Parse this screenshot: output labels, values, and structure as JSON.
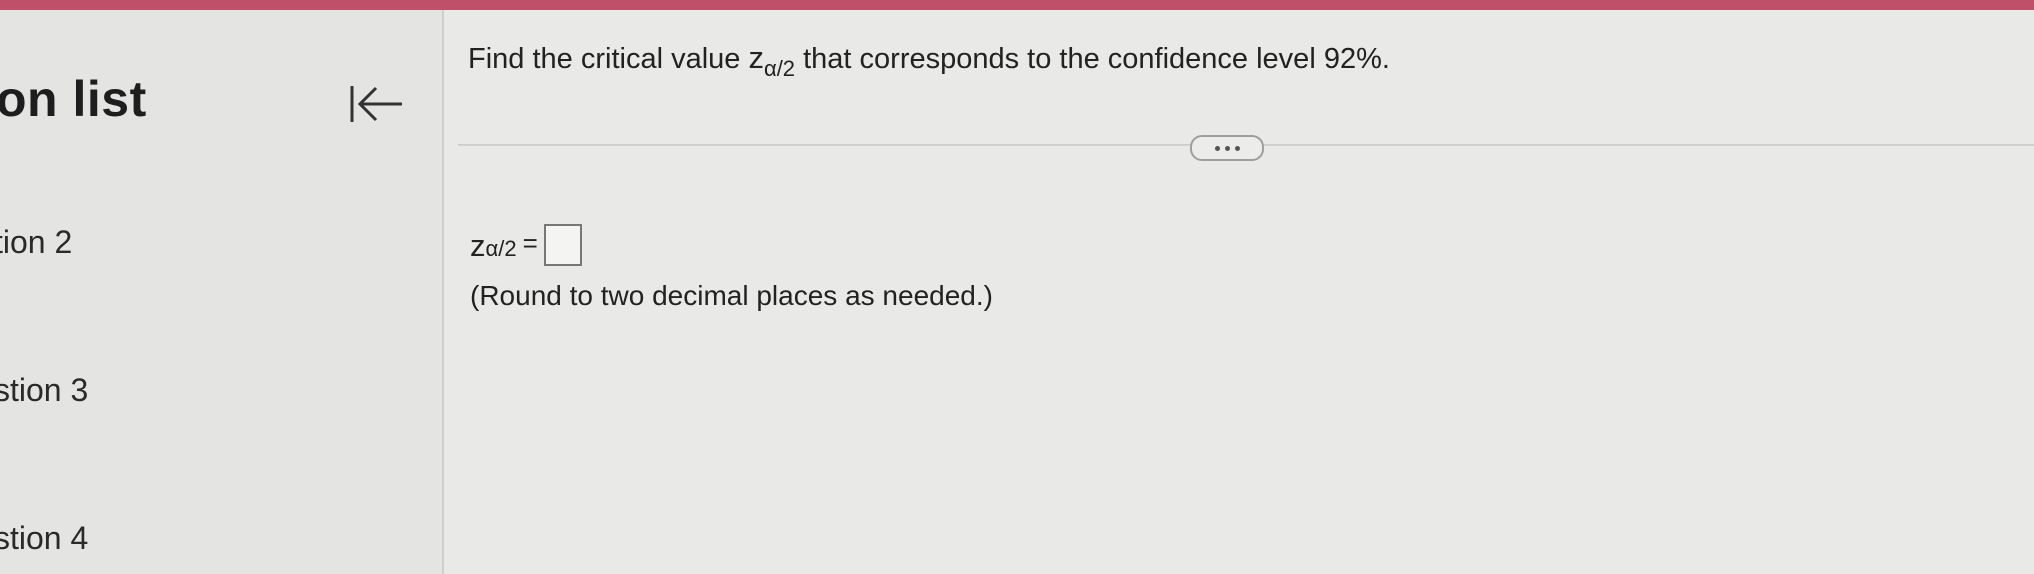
{
  "sidebar": {
    "title": "on list",
    "items": [
      {
        "label": "tion 2"
      },
      {
        "label": "stion 3"
      },
      {
        "label": "stion 4"
      }
    ]
  },
  "question": {
    "prefix": "Find the critical value ",
    "z_symbol": "z",
    "z_subscript": "α/2",
    "suffix": " that corresponds to the confidence level 92%."
  },
  "answer": {
    "z_symbol": "z",
    "z_subscript": "α/2",
    "equals": "=",
    "value": ""
  },
  "hint": "(Round to two decimal places as needed.)",
  "colors": {
    "topbar": "#c0506a",
    "background": "#e9e9e7"
  },
  "icons": {
    "collapse": "collapse-left-icon",
    "more": "more-options-icon"
  }
}
